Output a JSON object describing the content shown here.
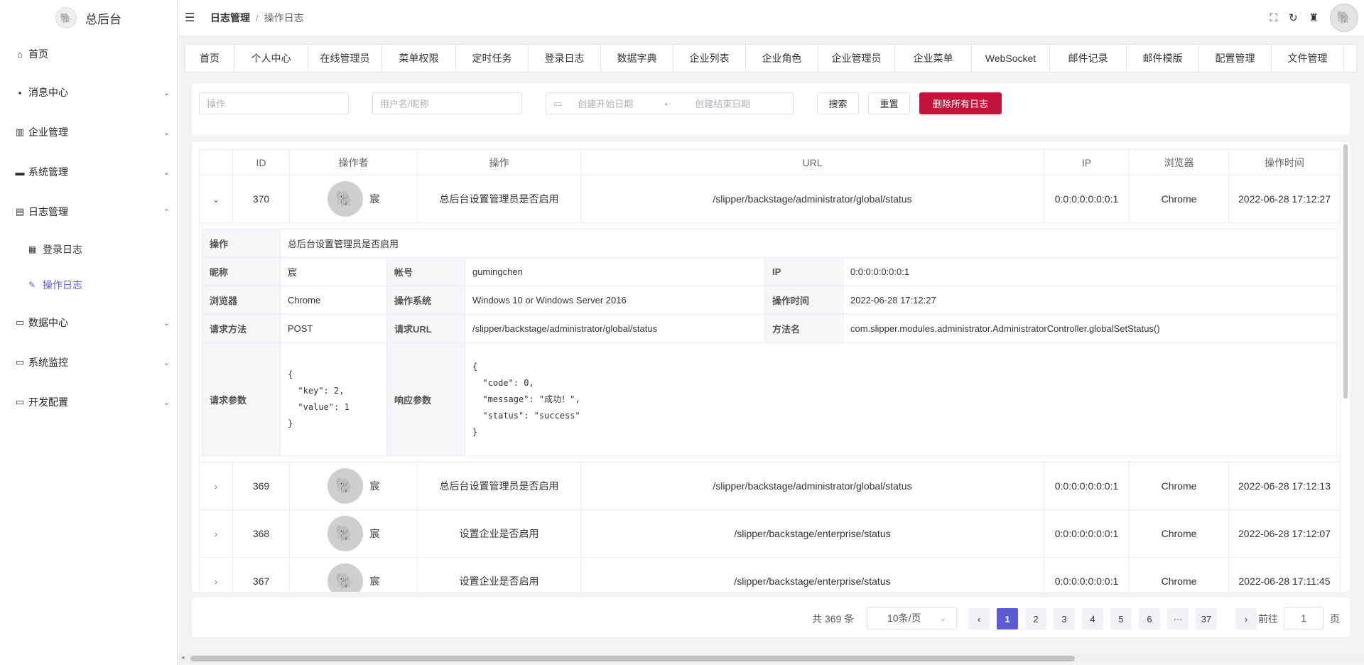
{
  "app": {
    "title": "总后台"
  },
  "sidebar": {
    "items": [
      {
        "label": "首页",
        "icon": "home-icon"
      },
      {
        "label": "消息中心",
        "icon": "message-icon"
      },
      {
        "label": "企业管理",
        "icon": "chart-icon"
      },
      {
        "label": "系统管理",
        "icon": "computer-icon"
      },
      {
        "label": "日志管理",
        "icon": "log-icon"
      },
      {
        "label": "数据中心",
        "icon": "monitor-icon"
      },
      {
        "label": "系统监控",
        "icon": "monitor-icon"
      },
      {
        "label": "开发配置",
        "icon": "monitor-icon"
      }
    ],
    "subitems": [
      {
        "label": "登录日志",
        "icon": "document-icon"
      },
      {
        "label": "操作日志",
        "icon": "edit-icon"
      }
    ]
  },
  "header": {
    "breadcrumb": [
      "日志管理",
      "操作日志"
    ],
    "sep": "/"
  },
  "tabs": [
    "首页",
    "个人中心",
    "在线管理员",
    "菜单权限",
    "定时任务",
    "登录日志",
    "数据字典",
    "企业列表",
    "企业角色",
    "企业管理员",
    "企业菜单",
    "WebSocket",
    "邮件记录",
    "邮件模版",
    "配置管理",
    "文件管理"
  ],
  "filters": {
    "operation_placeholder": "操作",
    "user_placeholder": "用户名/昵称",
    "start_date_placeholder": "创建开始日期",
    "date_sep": "-",
    "end_date_placeholder": "创建结束日期",
    "search_label": "搜索",
    "reset_label": "重置",
    "delete_all_label": "删除所有日志"
  },
  "table": {
    "columns": [
      "ID",
      "操作者",
      "操作",
      "URL",
      "IP",
      "浏览器",
      "操作时间"
    ],
    "rows": [
      {
        "id": "370",
        "user": "宸",
        "op": "总后台设置管理员是否启用",
        "url": "/slipper/backstage/administrator/global/status",
        "ip": "0:0:0:0:0:0:0:1",
        "browser": "Chrome",
        "time": "2022-06-28 17:12:27"
      },
      {
        "id": "369",
        "user": "宸",
        "op": "总后台设置管理员是否启用",
        "url": "/slipper/backstage/administrator/global/status",
        "ip": "0:0:0:0:0:0:0:1",
        "browser": "Chrome",
        "time": "2022-06-28 17:12:13"
      },
      {
        "id": "368",
        "user": "宸",
        "op": "设置企业是否启用",
        "url": "/slipper/backstage/enterprise/status",
        "ip": "0:0:0:0:0:0:0:1",
        "browser": "Chrome",
        "time": "2022-06-28 17:12:07"
      },
      {
        "id": "367",
        "user": "宸",
        "op": "设置企业是否启用",
        "url": "/slipper/backstage/enterprise/status",
        "ip": "0:0:0:0:0:0:0:1",
        "browser": "Chrome",
        "time": "2022-06-28 17:11:45"
      }
    ]
  },
  "detail": {
    "op_label": "操作",
    "op_value": "总后台设置管理员是否启用",
    "nick_label": "昵称",
    "nick_value": "宸",
    "account_label": "帐号",
    "account_value": "gumingchen",
    "ip_label": "IP",
    "ip_value": "0:0:0:0:0:0:0:1",
    "browser_label": "浏览器",
    "browser_value": "Chrome",
    "os_label": "操作系统",
    "os_value": "Windows 10 or Windows Server 2016",
    "time_label": "操作时间",
    "time_value": "2022-06-28 17:12:27",
    "method_label": "请求方法",
    "method_value": "POST",
    "url_label": "请求URL",
    "url_value": "/slipper/backstage/administrator/global/status",
    "fn_label": "方法名",
    "fn_value": "com.slipper.modules.administrator.AdministratorController.globalSetStatus()",
    "params_label": "请求参数",
    "params_value": "{\n  \"key\": 2,\n  \"value\": 1\n}",
    "resp_label": "响应参数",
    "resp_value": "{\n  \"code\": 0,\n  \"message\": \"成功！\",\n  \"status\": \"success\"\n}"
  },
  "pagination": {
    "total_text": "共 369 条",
    "page_size": "10条/页",
    "prev": "‹",
    "pages": [
      "1",
      "2",
      "3",
      "4",
      "5",
      "6",
      "···",
      "37"
    ],
    "next": "›",
    "goto_label": "前往",
    "goto_value": "1",
    "page_suffix": "页"
  },
  "colors": {
    "accent": "#5b5bd6",
    "danger": "#c2153c"
  }
}
